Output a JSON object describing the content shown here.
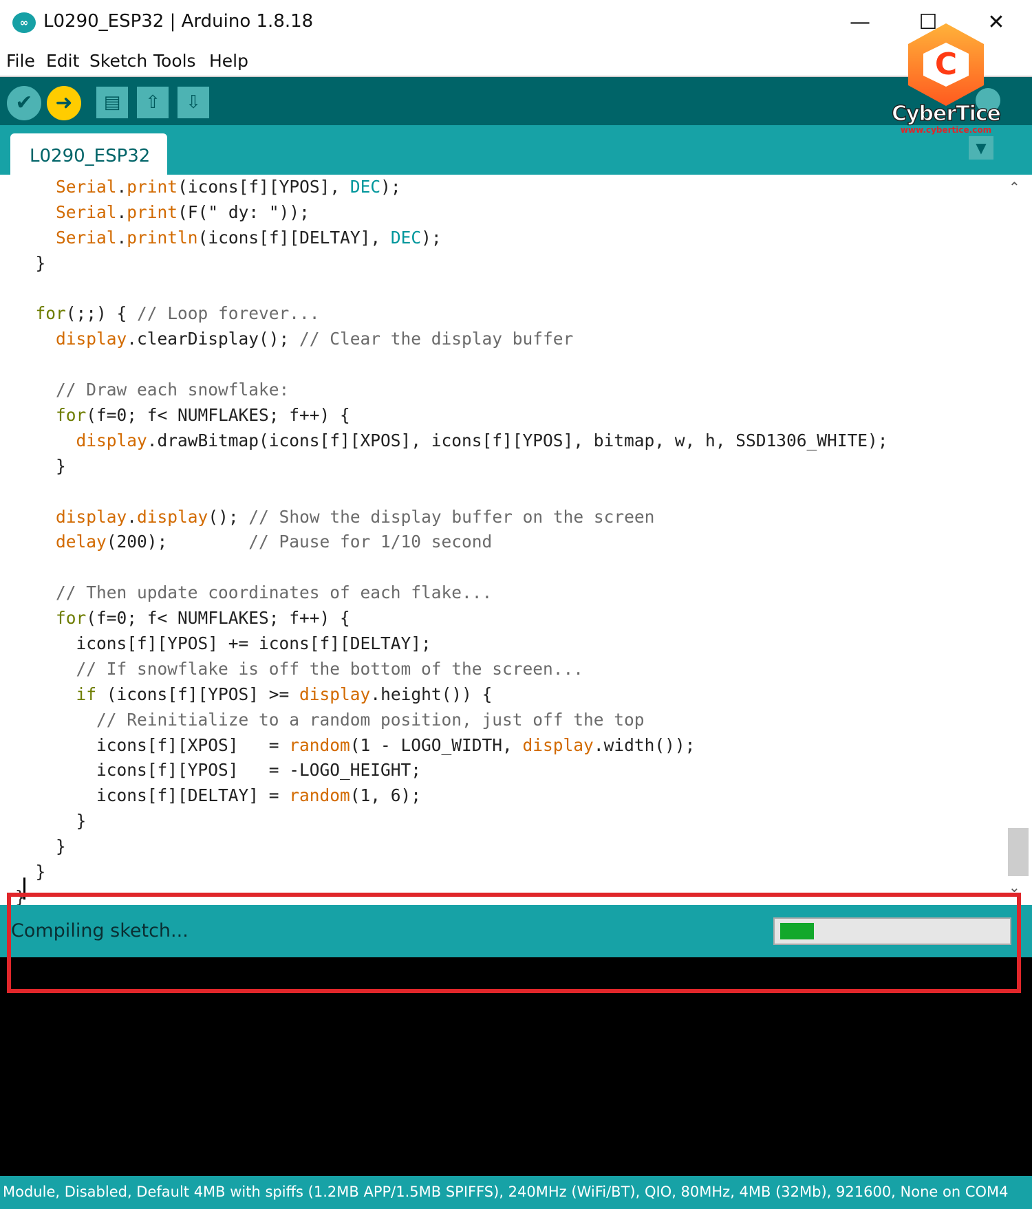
{
  "window": {
    "title": "L0290_ESP32 | Arduino 1.8.18",
    "app_icon": "∞",
    "minimize": "—",
    "maximize": "☐",
    "close": "✕"
  },
  "menu": {
    "items": [
      "File",
      "Edit",
      "Sketch",
      "Tools",
      "Help"
    ]
  },
  "toolbar": {
    "verify_glyph": "✔",
    "upload_glyph": "➜",
    "new_glyph": "▤",
    "open_glyph": "⇧",
    "save_glyph": "⇩",
    "verify_color": "#4db3b3",
    "upload_color": "#ffcc00"
  },
  "logo": {
    "letter": "C",
    "name": "CyberTice",
    "url": "www.cybertice.com"
  },
  "tabs": {
    "active_label": "L0290_ESP32",
    "menu_glyph": "▼"
  },
  "editor": {
    "scroll_up": "⌃",
    "scroll_down": "⌄",
    "lines": [
      [
        [
          "    ",
          ""
        ],
        [
          "Serial",
          "obj"
        ],
        [
          ".",
          ""
        ],
        [
          "print",
          "fn"
        ],
        [
          "(icons[f][YPOS], ",
          ""
        ],
        [
          "DEC",
          "const"
        ],
        [
          ");",
          ""
        ]
      ],
      [
        [
          "    ",
          ""
        ],
        [
          "Serial",
          "obj"
        ],
        [
          ".",
          ""
        ],
        [
          "print",
          "fn"
        ],
        [
          "(F(\" dy: \"));",
          ""
        ]
      ],
      [
        [
          "    ",
          ""
        ],
        [
          "Serial",
          "obj"
        ],
        [
          ".",
          ""
        ],
        [
          "println",
          "fn"
        ],
        [
          "(icons[f][DELTAY], ",
          ""
        ],
        [
          "DEC",
          "const"
        ],
        [
          ");",
          ""
        ]
      ],
      [
        [
          "  }",
          ""
        ]
      ],
      [
        [
          "",
          ""
        ]
      ],
      [
        [
          "  ",
          ""
        ],
        [
          "for",
          "kw"
        ],
        [
          "(;;) { ",
          ""
        ],
        [
          "// Loop forever...",
          "cm"
        ]
      ],
      [
        [
          "    ",
          ""
        ],
        [
          "display",
          "obj"
        ],
        [
          ".clearDisplay(); ",
          ""
        ],
        [
          "// Clear the display buffer",
          "cm"
        ]
      ],
      [
        [
          "",
          ""
        ]
      ],
      [
        [
          "    ",
          ""
        ],
        [
          "// Draw each snowflake:",
          "cm"
        ]
      ],
      [
        [
          "    ",
          ""
        ],
        [
          "for",
          "kw"
        ],
        [
          "(f=0; f< NUMFLAKES; f++) {",
          ""
        ]
      ],
      [
        [
          "      ",
          ""
        ],
        [
          "display",
          "obj"
        ],
        [
          ".drawBitmap(icons[f][XPOS], icons[f][YPOS], bitmap, w, h, SSD1306_WHITE);",
          ""
        ]
      ],
      [
        [
          "    }",
          ""
        ]
      ],
      [
        [
          "",
          ""
        ]
      ],
      [
        [
          "    ",
          ""
        ],
        [
          "display",
          "obj"
        ],
        [
          ".",
          ""
        ],
        [
          "display",
          "obj"
        ],
        [
          "(); ",
          ""
        ],
        [
          "// Show the display buffer on the screen",
          "cm"
        ]
      ],
      [
        [
          "    ",
          ""
        ],
        [
          "delay",
          "fn"
        ],
        [
          "(200);        ",
          ""
        ],
        [
          "// Pause for 1/10 second",
          "cm"
        ]
      ],
      [
        [
          "",
          ""
        ]
      ],
      [
        [
          "    ",
          ""
        ],
        [
          "// Then update coordinates of each flake...",
          "cm"
        ]
      ],
      [
        [
          "    ",
          ""
        ],
        [
          "for",
          "kw"
        ],
        [
          "(f=0; f< NUMFLAKES; f++) {",
          ""
        ]
      ],
      [
        [
          "      icons[f][YPOS] += icons[f][DELTAY];",
          ""
        ]
      ],
      [
        [
          "      ",
          ""
        ],
        [
          "// If snowflake is off the bottom of the screen...",
          "cm"
        ]
      ],
      [
        [
          "      ",
          ""
        ],
        [
          "if",
          "kw"
        ],
        [
          " (icons[f][YPOS] >= ",
          ""
        ],
        [
          "display",
          "obj"
        ],
        [
          ".height()) {",
          ""
        ]
      ],
      [
        [
          "        ",
          ""
        ],
        [
          "// Reinitialize to a random position, just off the top",
          "cm"
        ]
      ],
      [
        [
          "        icons[f][XPOS]   = ",
          ""
        ],
        [
          "random",
          "fn"
        ],
        [
          "(1 - LOGO_WIDTH, ",
          ""
        ],
        [
          "display",
          "obj"
        ],
        [
          ".width());",
          ""
        ]
      ],
      [
        [
          "        icons[f][YPOS]   = -LOGO_HEIGHT;",
          ""
        ]
      ],
      [
        [
          "        icons[f][DELTAY] = ",
          ""
        ],
        [
          "random",
          "fn"
        ],
        [
          "(1, 6);",
          ""
        ]
      ],
      [
        [
          "      }",
          ""
        ]
      ],
      [
        [
          "    }",
          ""
        ]
      ],
      [
        [
          "  }",
          ""
        ]
      ],
      [
        [
          "}",
          ""
        ]
      ]
    ]
  },
  "status": {
    "message": "Compiling sketch...",
    "progress_percent": 15,
    "progress_color": "#12a82b"
  },
  "footer": {
    "board_info": "Module, Disabled, Default 4MB with spiffs (1.2MB APP/1.5MB SPIFFS), 240MHz (WiFi/BT), QIO, 80MHz, 4MB (32Mb), 921600, None on COM4"
  },
  "colors": {
    "toolbar_bg": "#006468",
    "tabbar_bg": "#17a2a6",
    "highlight_border": "#e0262a"
  }
}
